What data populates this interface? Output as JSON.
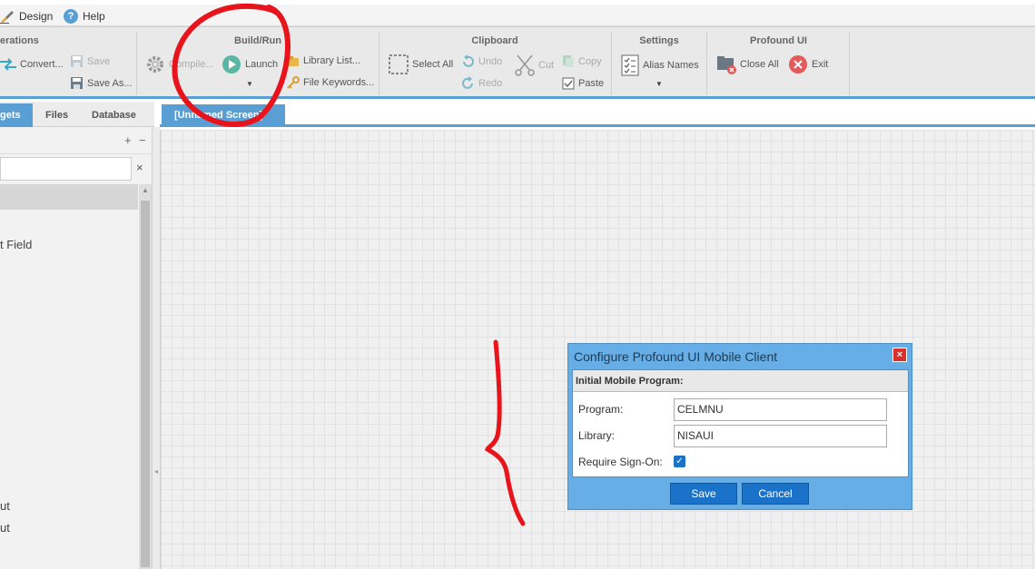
{
  "menu": {
    "design": "Design",
    "help": "Help"
  },
  "ribbon": {
    "operations": {
      "title": "erations",
      "convert": "Convert...",
      "save": "Save",
      "save_as": "Save As..."
    },
    "build_run": {
      "title": "Build/Run",
      "compile": "Compile...",
      "launch": "Launch",
      "library_list": "Library List...",
      "file_keywords": "File Keywords..."
    },
    "clipboard": {
      "title": "Clipboard",
      "select_all": "Select All",
      "undo": "Undo",
      "redo": "Redo",
      "cut": "Cut",
      "copy": "Copy",
      "paste": "Paste"
    },
    "settings": {
      "title": "Settings",
      "alias_names": "Alias Names"
    },
    "profound_ui": {
      "title": "Profound UI",
      "close_all": "Close All",
      "exit": "Exit"
    }
  },
  "left_panel": {
    "tabs": [
      "gets",
      "Files",
      "Database"
    ],
    "expand": "+",
    "collapse": "−",
    "clear": "×",
    "items": [
      "t Field",
      "ut",
      "ut"
    ]
  },
  "canvas": {
    "tab_label": "[Unnamed Screen]"
  },
  "dialog": {
    "title": "Configure Profound UI Mobile Client",
    "close": "×",
    "section": "Initial Mobile Program:",
    "program_label": "Program:",
    "program_value": "CELMNU",
    "library_label": "Library:",
    "library_value": "NISAUI",
    "signon_label": "Require Sign-On:",
    "signon_checked": true,
    "save": "Save",
    "cancel": "Cancel"
  },
  "colors": {
    "accent": "#5a9fd4",
    "button": "#1a73c9",
    "annotation": "#e8141b"
  }
}
